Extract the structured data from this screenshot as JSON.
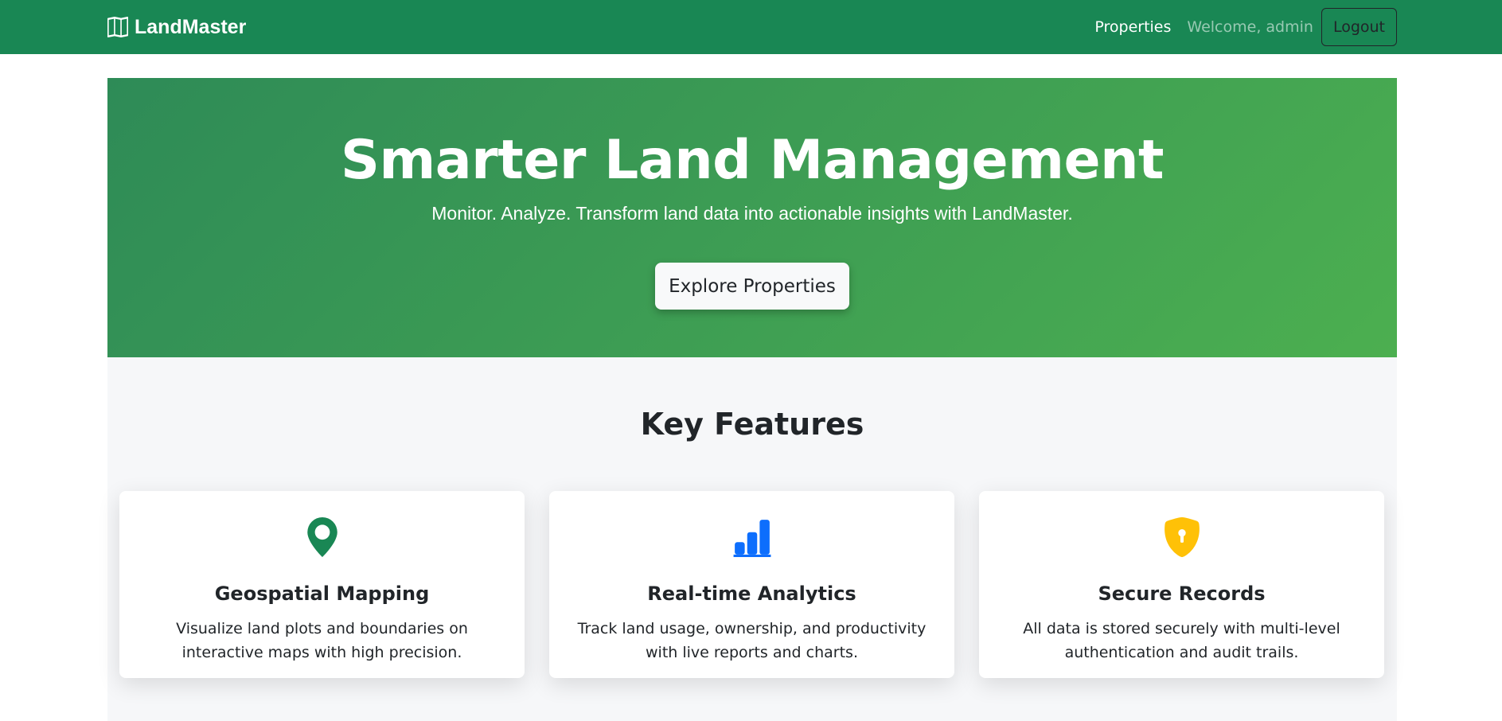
{
  "navbar": {
    "brand": "LandMaster",
    "brand_icon": "map-icon",
    "links": {
      "properties": "Properties"
    },
    "welcome": "Welcome, admin",
    "logout": "Logout",
    "bg_color": "#198754"
  },
  "hero": {
    "title": "Smarter Land Management",
    "subtitle": "Monitor. Analyze. Transform land data into actionable insights with LandMaster.",
    "cta": "Explore Properties",
    "gradient": [
      "#2e8b57",
      "#4caf50"
    ]
  },
  "features": {
    "title": "Key Features",
    "cards": [
      {
        "icon": "map-pin-icon",
        "icon_color": "#198754",
        "title": "Geospatial Mapping",
        "text": "Visualize land plots and boundaries on interactive maps with high precision."
      },
      {
        "icon": "bar-chart-icon",
        "icon_color": "#0d6efd",
        "title": "Real-time Analytics",
        "text": "Track land usage, ownership, and productivity with live reports and charts."
      },
      {
        "icon": "shield-lock-icon",
        "icon_color": "#ffc107",
        "title": "Secure Records",
        "text": "All data is stored securely with multi-level authentication and audit trails."
      }
    ]
  }
}
